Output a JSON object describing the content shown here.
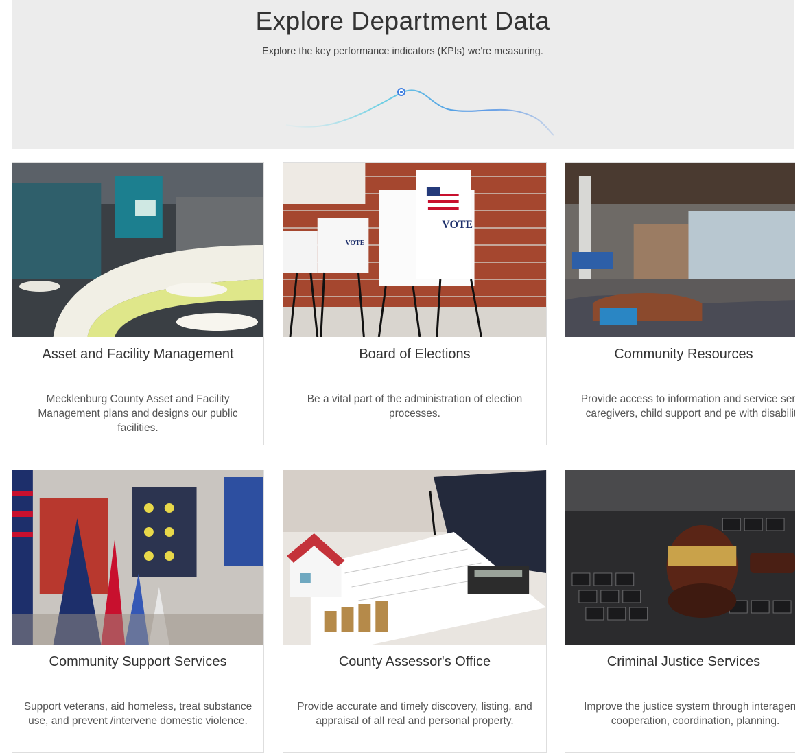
{
  "header": {
    "title": "Explore Department Data",
    "subtitle": "Explore the key performance indicators (KPIs) we're measuring."
  },
  "cards": [
    {
      "title": "Asset and Facility Management",
      "description": "Mecklenburg County Asset and Facility Management plans and designs our public facilities.",
      "image": "modern-lobby-with-curved-bench-photo"
    },
    {
      "title": "Board of Elections",
      "description": "Be a vital part of the administration of election processes.",
      "image": "vote-booths-against-brick-wall-photo",
      "image_text": "VOTE"
    },
    {
      "title": "Community Resources",
      "description": "Provide access to information and service seniors, caregivers, child support and pe with disabilities.",
      "image": "open-office-lounge-photo"
    },
    {
      "title": "Community Support Services",
      "description": "Support veterans, aid homeless, treat substance use, and prevent /intervene domestic violence.",
      "image": "flags-and-quilts-photo"
    },
    {
      "title": "County Assessor's Office",
      "description": "Provide accurate and timely discovery, listing, and appraisal of all real and personal property.",
      "image": "house-model-coins-calculator-photo"
    },
    {
      "title": "Criminal Justice Services",
      "description": "Improve the justice system through interagency cooperation, coordination, planning.",
      "image": "gavel-on-laptop-keyboard-photo"
    }
  ],
  "colors": {
    "hero_bg": "#ececec",
    "wave_start": "#8fd6e6",
    "wave_end": "#3f7fe0",
    "card_border": "#dedede"
  }
}
